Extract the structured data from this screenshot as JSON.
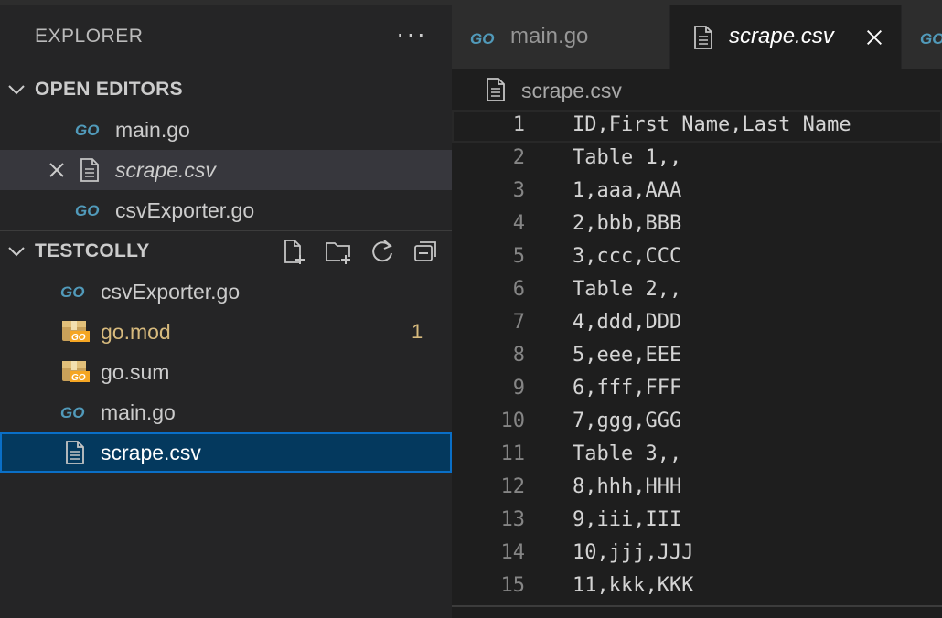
{
  "explorer": {
    "title": "EXPLORER",
    "more_label": "···",
    "open_editors": {
      "title": "OPEN EDITORS",
      "items": [
        {
          "label": "main.go",
          "icon": "go-icon"
        },
        {
          "label": "scrape.csv",
          "icon": "file-icon",
          "active": true
        },
        {
          "label": "csvExporter.go",
          "icon": "go-icon"
        }
      ]
    },
    "folder": {
      "title": "TESTCOLLY",
      "items": [
        {
          "label": "csvExporter.go",
          "icon": "go-icon"
        },
        {
          "label": "go.mod",
          "icon": "go-module-icon",
          "badge": "1"
        },
        {
          "label": "go.sum",
          "icon": "go-module-icon"
        },
        {
          "label": "main.go",
          "icon": "go-icon"
        },
        {
          "label": "scrape.csv",
          "icon": "file-icon",
          "selected": true
        }
      ]
    }
  },
  "tabs": [
    {
      "label": "main.go",
      "icon": "go-icon"
    },
    {
      "label": "scrape.csv",
      "icon": "file-icon",
      "active": true
    }
  ],
  "breadcrumb": {
    "label": "scrape.csv"
  },
  "code": {
    "lines": [
      {
        "n": "1",
        "text": "ID,First Name,Last Name"
      },
      {
        "n": "2",
        "text": "Table 1,,"
      },
      {
        "n": "3",
        "text": "1,aaa,AAA"
      },
      {
        "n": "4",
        "text": "2,bbb,BBB"
      },
      {
        "n": "5",
        "text": "3,ccc,CCC"
      },
      {
        "n": "6",
        "text": "Table 2,,"
      },
      {
        "n": "7",
        "text": "4,ddd,DDD"
      },
      {
        "n": "8",
        "text": "5,eee,EEE"
      },
      {
        "n": "9",
        "text": "6,fff,FFF"
      },
      {
        "n": "10",
        "text": "7,ggg,GGG"
      },
      {
        "n": "11",
        "text": "Table 3,,"
      },
      {
        "n": "12",
        "text": "8,hhh,HHH"
      },
      {
        "n": "13",
        "text": "9,iii,III"
      },
      {
        "n": "14",
        "text": "10,jjj,JJJ"
      },
      {
        "n": "15",
        "text": "11,kkk,KKK"
      }
    ]
  },
  "colors": {
    "go_blue": "#519aba",
    "modified": "#d7ba7d",
    "selection": "#04395e"
  }
}
